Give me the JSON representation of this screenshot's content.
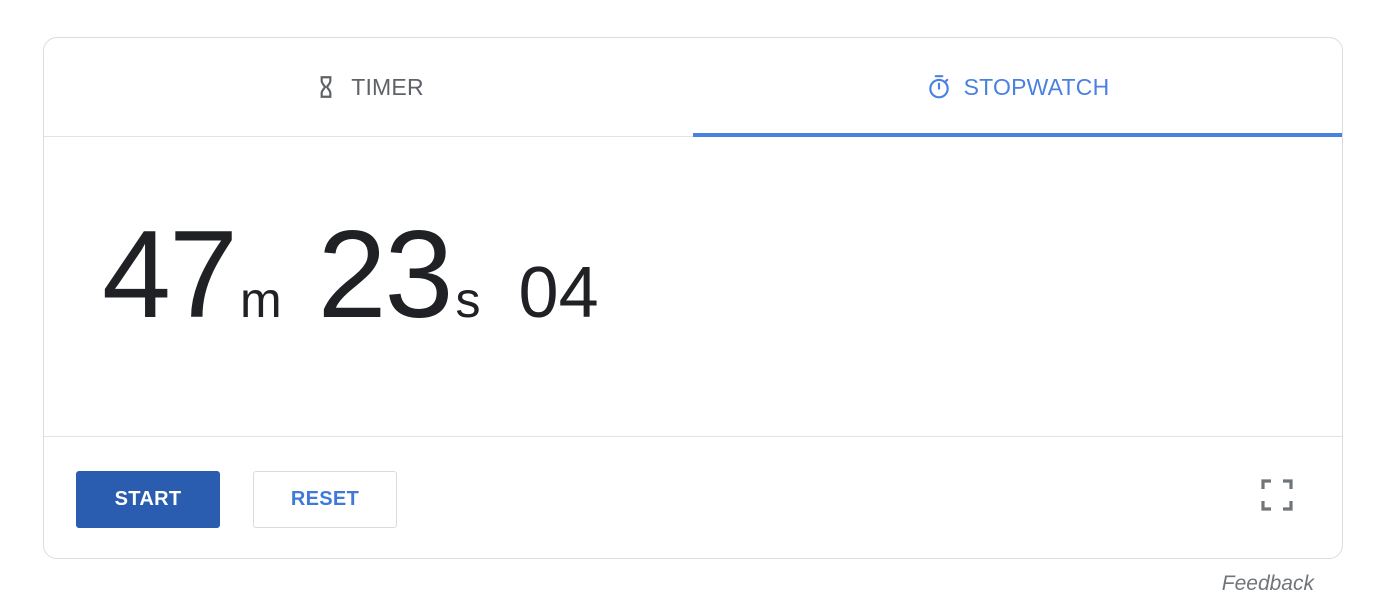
{
  "tabs": [
    {
      "label": "TIMER",
      "icon": "hourglass-icon",
      "active": false
    },
    {
      "label": "STOPWATCH",
      "icon": "stopwatch-icon",
      "active": true
    }
  ],
  "display": {
    "minutes": "47",
    "minutes_unit": "m",
    "seconds": "23",
    "seconds_unit": "s",
    "hundredths": "04"
  },
  "controls": {
    "start_label": "START",
    "reset_label": "RESET",
    "fullscreen_icon": "fullscreen-icon"
  },
  "footer": {
    "feedback_label": "Feedback"
  },
  "colors": {
    "accent": "#4a80e0",
    "primary_button": "#2a5db0",
    "text": "#202124",
    "muted": "#5f6368"
  }
}
